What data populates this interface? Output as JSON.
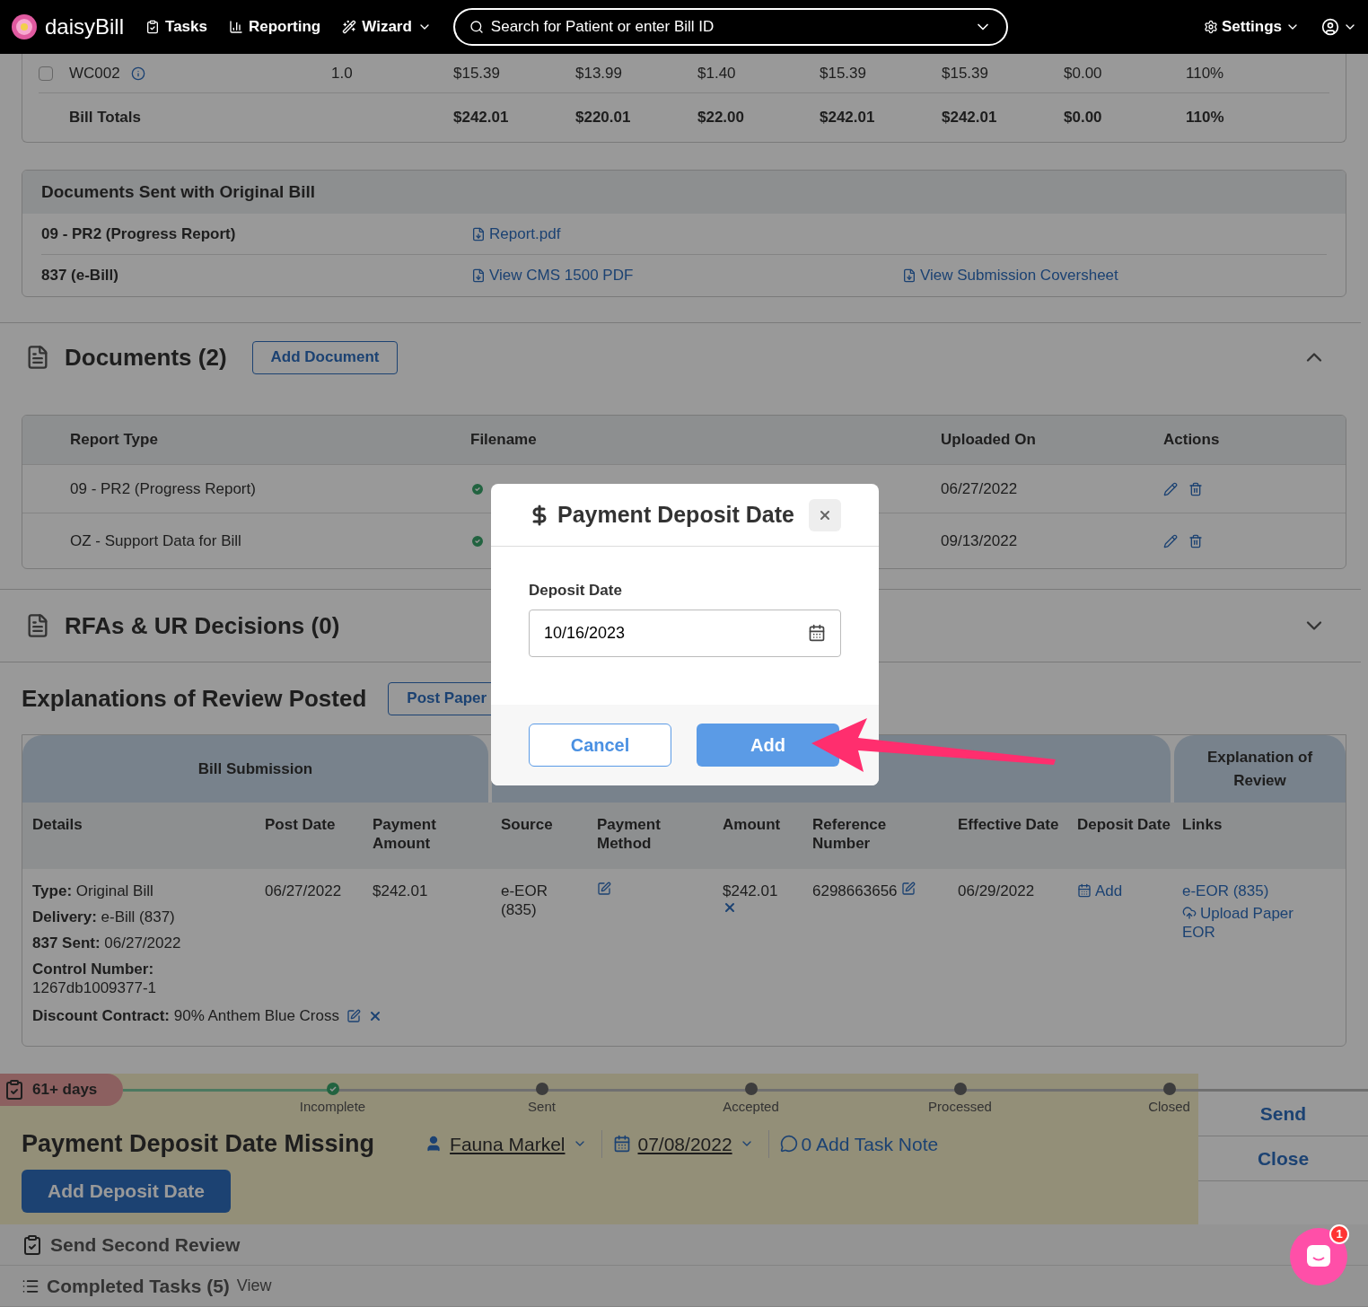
{
  "nav": {
    "logo": "daisyBill",
    "items": [
      {
        "label": "Tasks",
        "kind": "tasks"
      },
      {
        "label": "Reporting",
        "kind": "reporting"
      },
      {
        "label": "Wizard",
        "kind": "wizard"
      }
    ],
    "search": {
      "placeholder": "Search for Patient or enter Bill ID"
    },
    "settings": "Settings"
  },
  "line_items": {
    "rows": [
      {
        "checked": false,
        "code": "WC002",
        "units": "1.0",
        "values": [
          "$15.39",
          "$13.99",
          "$1.40",
          "$15.39",
          "$15.39",
          "$0.00",
          "110%"
        ]
      }
    ],
    "totals": {
      "label": "Bill Totals",
      "values": [
        "$242.01",
        "$220.01",
        "$22.00",
        "$242.01",
        "$242.01",
        "$0.00",
        "110%"
      ]
    }
  },
  "documents_sent": {
    "title": "Documents Sent with Original Bill",
    "rows": [
      {
        "label": "09 - PR2 (Progress Report)",
        "links": [
          "Report.pdf"
        ]
      },
      {
        "label": "837 (e-Bill)",
        "links": [
          "View CMS 1500 PDF",
          "View Submission Coversheet"
        ]
      }
    ]
  },
  "documents": {
    "title": "Documents (2)",
    "button": "Add Document",
    "expanded": true,
    "columns": [
      "Report Type",
      "Filename",
      "Uploaded On",
      "Actions"
    ],
    "rows": [
      {
        "report_type": "09 - PR2 (Progress Report)",
        "uploaded_on": "06/27/2022"
      },
      {
        "report_type": "OZ - Support Data for Bill",
        "uploaded_on": "09/13/2022"
      }
    ]
  },
  "rfas": {
    "title": "RFAs & UR Decisions (0)",
    "expanded": false
  },
  "eor": {
    "title": "Explanations of Review Posted",
    "button": "Post Paper",
    "groups": [
      {
        "kind": "titled",
        "label": "Bill Submission"
      },
      {
        "kind": "blank"
      },
      {
        "kind": "titled",
        "label": "Explanation of Review"
      }
    ],
    "columns": [
      "Details",
      "Post Date",
      "Payment Amount",
      "Source",
      "Payment Method",
      "Amount",
      "Reference Number",
      "Effective Date",
      "Deposit Date",
      "Links"
    ],
    "row": {
      "details": [
        "**Type:** Original Bill",
        "**Delivery:** e-Bill (837)",
        "**837 Sent:** 06/27/2022",
        "**Control Number:** 1267db1009377-1",
        "**Discount Contract:** 90% Anthem Blue Cross"
      ],
      "post_date": "06/27/2022",
      "payment_amount": "$242.01",
      "source": "e-EOR (835)",
      "amount": "$242.01",
      "reference_number": "6298663656",
      "effective_date": "06/29/2022",
      "deposit_date": "Add",
      "links": [
        "e-EOR (835)",
        "Upload Paper EOR"
      ]
    }
  },
  "task": {
    "age": "61+ days",
    "steps": [
      {
        "label": "Incomplete",
        "done": true
      },
      {
        "label": "Sent",
        "done": false
      },
      {
        "label": "Accepted",
        "done": false
      },
      {
        "label": "Processed",
        "done": false
      },
      {
        "label": "Closed",
        "done": false
      }
    ],
    "title": "Payment Deposit Date Missing",
    "assignee": "Fauna Markel",
    "due": "07/08/2022",
    "note": "0 Add Task Note",
    "button": "Add Deposit Date",
    "actions": [
      "Send",
      "Close"
    ]
  },
  "other_tasks": [
    {
      "label": "Send Second Review",
      "kind": "task"
    },
    {
      "label": "Completed Tasks (5)",
      "kind": "list",
      "link": "View"
    }
  ],
  "modal": {
    "title": "Payment Deposit Date",
    "field_label": "Deposit Date",
    "value": "10/16/2023",
    "buttons": [
      "Cancel",
      "Add"
    ]
  },
  "chat": {
    "badge": "1"
  }
}
